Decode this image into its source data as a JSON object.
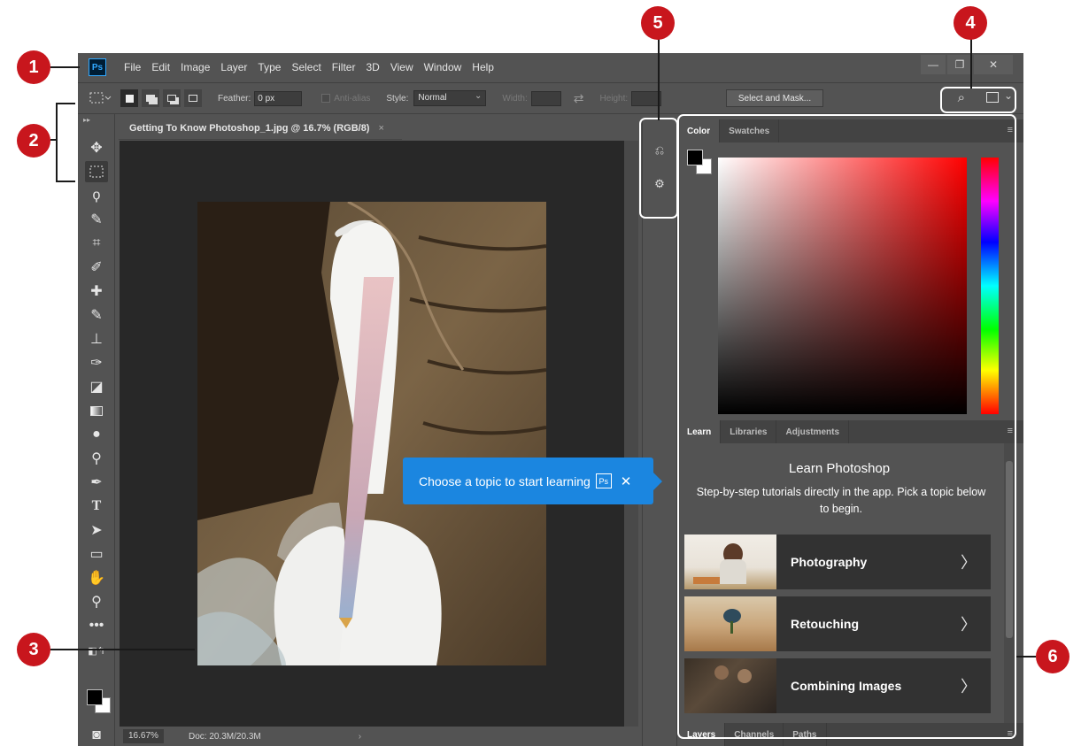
{
  "callouts": [
    "1",
    "2",
    "3",
    "4",
    "5",
    "6"
  ],
  "app": {
    "logo": "Ps",
    "menu": [
      "File",
      "Edit",
      "Image",
      "Layer",
      "Type",
      "Select",
      "Filter",
      "3D",
      "View",
      "Window",
      "Help"
    ],
    "window_buttons": [
      "—",
      "❐",
      "✕"
    ]
  },
  "options": {
    "feather_label": "Feather:",
    "feather_value": "0 px",
    "antialias_label": "Anti-alias",
    "style_label": "Style:",
    "style_value": "Normal",
    "width_label": "Width:",
    "height_label": "Height:",
    "select_mask": "Select and Mask..."
  },
  "document": {
    "tab_title": "Getting To Know Photoshop_1.jpg @ 16.7% (RGB/8)",
    "tab_close": "×",
    "zoom": "16.67%",
    "doc_info": "Doc: 20.3M/20.3M",
    "status_arrow": "›"
  },
  "tooltip": {
    "text": "Choose a topic to start learning",
    "badge": "Ps",
    "close": "✕"
  },
  "color_panel": {
    "tabs": [
      "Color",
      "Swatches"
    ]
  },
  "learn_panel": {
    "tabs": [
      "Learn",
      "Libraries",
      "Adjustments"
    ],
    "title": "Learn Photoshop",
    "subtitle": "Step-by-step tutorials directly in the app. Pick a topic below to begin.",
    "topics": [
      "Photography",
      "Retouching",
      "Combining Images"
    ]
  },
  "layers_panel": {
    "tabs": [
      "Layers",
      "Channels",
      "Paths"
    ]
  },
  "colors": {
    "callout": "#c8161d",
    "ui_bg": "#535353",
    "canvas": "#282828",
    "tooltip": "#1b86e0"
  }
}
